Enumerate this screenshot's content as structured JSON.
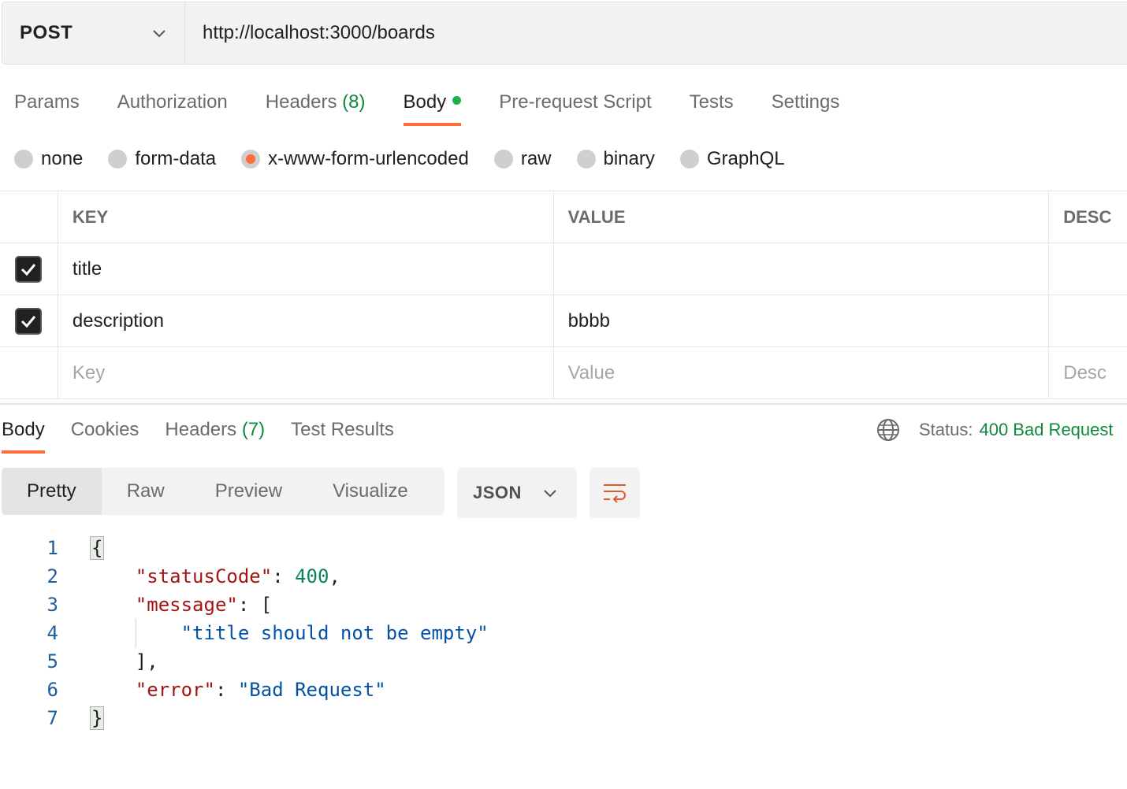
{
  "request": {
    "method": "POST",
    "url": "http://localhost:3000/boards"
  },
  "request_tabs": [
    {
      "label": "Params"
    },
    {
      "label": "Authorization"
    },
    {
      "label": "Headers",
      "count": "(8)"
    },
    {
      "label": "Body",
      "active": true
    },
    {
      "label": "Pre-request Script"
    },
    {
      "label": "Tests"
    },
    {
      "label": "Settings"
    }
  ],
  "body_types": [
    {
      "label": "none"
    },
    {
      "label": "form-data"
    },
    {
      "label": "x-www-form-urlencoded",
      "selected": true
    },
    {
      "label": "raw"
    },
    {
      "label": "binary"
    },
    {
      "label": "GraphQL"
    }
  ],
  "params_table": {
    "headers": {
      "key": "KEY",
      "value": "VALUE",
      "description": "DESC"
    },
    "rows": [
      {
        "key": "title",
        "value": "",
        "checked": true
      },
      {
        "key": "description",
        "value": "bbbb",
        "checked": true
      }
    ],
    "placeholders": {
      "key": "Key",
      "value": "Value",
      "description": "Desc"
    }
  },
  "response_tabs": [
    {
      "label": "Body",
      "active": true
    },
    {
      "label": "Cookies"
    },
    {
      "label": "Headers",
      "count": "(7)"
    },
    {
      "label": "Test Results"
    }
  ],
  "response_status": {
    "label": "Status:",
    "value": "400 Bad Request"
  },
  "format_buttons": [
    "Pretty",
    "Raw",
    "Preview",
    "Visualize"
  ],
  "language": "JSON",
  "code": {
    "line_numbers": [
      "1",
      "2",
      "3",
      "4",
      "5",
      "6",
      "7"
    ],
    "open_brace": "{",
    "close_brace": "}",
    "status_key": "\"statusCode\"",
    "status_value": "400",
    "message_key": "\"message\"",
    "message_item": "\"title should not be empty\"",
    "error_key": "\"error\"",
    "error_value": "\"Bad Request\""
  },
  "colors": {
    "accent": "#ff6c37",
    "success": "#0f8a3c",
    "json_key": "#a31515",
    "json_number": "#098658",
    "json_string": "#0451a5"
  }
}
